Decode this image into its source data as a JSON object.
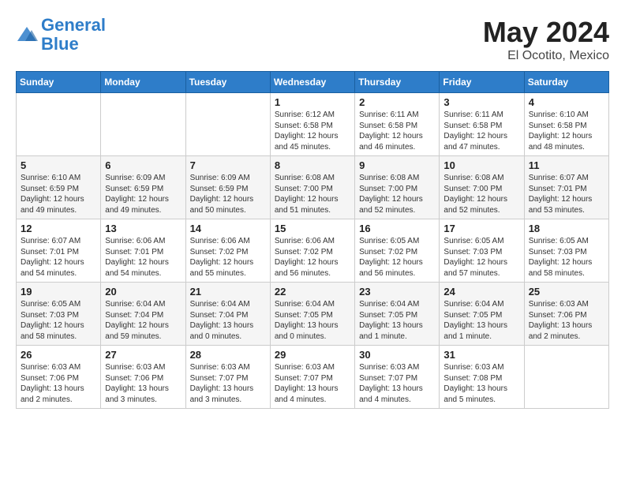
{
  "header": {
    "logo_line1": "General",
    "logo_line2": "Blue",
    "month": "May 2024",
    "location": "El Ocotito, Mexico"
  },
  "weekdays": [
    "Sunday",
    "Monday",
    "Tuesday",
    "Wednesday",
    "Thursday",
    "Friday",
    "Saturday"
  ],
  "weeks": [
    [
      {
        "day": "",
        "info": ""
      },
      {
        "day": "",
        "info": ""
      },
      {
        "day": "",
        "info": ""
      },
      {
        "day": "1",
        "info": "Sunrise: 6:12 AM\nSunset: 6:58 PM\nDaylight: 12 hours\nand 45 minutes."
      },
      {
        "day": "2",
        "info": "Sunrise: 6:11 AM\nSunset: 6:58 PM\nDaylight: 12 hours\nand 46 minutes."
      },
      {
        "day": "3",
        "info": "Sunrise: 6:11 AM\nSunset: 6:58 PM\nDaylight: 12 hours\nand 47 minutes."
      },
      {
        "day": "4",
        "info": "Sunrise: 6:10 AM\nSunset: 6:58 PM\nDaylight: 12 hours\nand 48 minutes."
      }
    ],
    [
      {
        "day": "5",
        "info": "Sunrise: 6:10 AM\nSunset: 6:59 PM\nDaylight: 12 hours\nand 49 minutes."
      },
      {
        "day": "6",
        "info": "Sunrise: 6:09 AM\nSunset: 6:59 PM\nDaylight: 12 hours\nand 49 minutes."
      },
      {
        "day": "7",
        "info": "Sunrise: 6:09 AM\nSunset: 6:59 PM\nDaylight: 12 hours\nand 50 minutes."
      },
      {
        "day": "8",
        "info": "Sunrise: 6:08 AM\nSunset: 7:00 PM\nDaylight: 12 hours\nand 51 minutes."
      },
      {
        "day": "9",
        "info": "Sunrise: 6:08 AM\nSunset: 7:00 PM\nDaylight: 12 hours\nand 52 minutes."
      },
      {
        "day": "10",
        "info": "Sunrise: 6:08 AM\nSunset: 7:00 PM\nDaylight: 12 hours\nand 52 minutes."
      },
      {
        "day": "11",
        "info": "Sunrise: 6:07 AM\nSunset: 7:01 PM\nDaylight: 12 hours\nand 53 minutes."
      }
    ],
    [
      {
        "day": "12",
        "info": "Sunrise: 6:07 AM\nSunset: 7:01 PM\nDaylight: 12 hours\nand 54 minutes."
      },
      {
        "day": "13",
        "info": "Sunrise: 6:06 AM\nSunset: 7:01 PM\nDaylight: 12 hours\nand 54 minutes."
      },
      {
        "day": "14",
        "info": "Sunrise: 6:06 AM\nSunset: 7:02 PM\nDaylight: 12 hours\nand 55 minutes."
      },
      {
        "day": "15",
        "info": "Sunrise: 6:06 AM\nSunset: 7:02 PM\nDaylight: 12 hours\nand 56 minutes."
      },
      {
        "day": "16",
        "info": "Sunrise: 6:05 AM\nSunset: 7:02 PM\nDaylight: 12 hours\nand 56 minutes."
      },
      {
        "day": "17",
        "info": "Sunrise: 6:05 AM\nSunset: 7:03 PM\nDaylight: 12 hours\nand 57 minutes."
      },
      {
        "day": "18",
        "info": "Sunrise: 6:05 AM\nSunset: 7:03 PM\nDaylight: 12 hours\nand 58 minutes."
      }
    ],
    [
      {
        "day": "19",
        "info": "Sunrise: 6:05 AM\nSunset: 7:03 PM\nDaylight: 12 hours\nand 58 minutes."
      },
      {
        "day": "20",
        "info": "Sunrise: 6:04 AM\nSunset: 7:04 PM\nDaylight: 12 hours\nand 59 minutes."
      },
      {
        "day": "21",
        "info": "Sunrise: 6:04 AM\nSunset: 7:04 PM\nDaylight: 13 hours\nand 0 minutes."
      },
      {
        "day": "22",
        "info": "Sunrise: 6:04 AM\nSunset: 7:05 PM\nDaylight: 13 hours\nand 0 minutes."
      },
      {
        "day": "23",
        "info": "Sunrise: 6:04 AM\nSunset: 7:05 PM\nDaylight: 13 hours\nand 1 minute."
      },
      {
        "day": "24",
        "info": "Sunrise: 6:04 AM\nSunset: 7:05 PM\nDaylight: 13 hours\nand 1 minute."
      },
      {
        "day": "25",
        "info": "Sunrise: 6:03 AM\nSunset: 7:06 PM\nDaylight: 13 hours\nand 2 minutes."
      }
    ],
    [
      {
        "day": "26",
        "info": "Sunrise: 6:03 AM\nSunset: 7:06 PM\nDaylight: 13 hours\nand 2 minutes."
      },
      {
        "day": "27",
        "info": "Sunrise: 6:03 AM\nSunset: 7:06 PM\nDaylight: 13 hours\nand 3 minutes."
      },
      {
        "day": "28",
        "info": "Sunrise: 6:03 AM\nSunset: 7:07 PM\nDaylight: 13 hours\nand 3 minutes."
      },
      {
        "day": "29",
        "info": "Sunrise: 6:03 AM\nSunset: 7:07 PM\nDaylight: 13 hours\nand 4 minutes."
      },
      {
        "day": "30",
        "info": "Sunrise: 6:03 AM\nSunset: 7:07 PM\nDaylight: 13 hours\nand 4 minutes."
      },
      {
        "day": "31",
        "info": "Sunrise: 6:03 AM\nSunset: 7:08 PM\nDaylight: 13 hours\nand 5 minutes."
      },
      {
        "day": "",
        "info": ""
      }
    ]
  ]
}
